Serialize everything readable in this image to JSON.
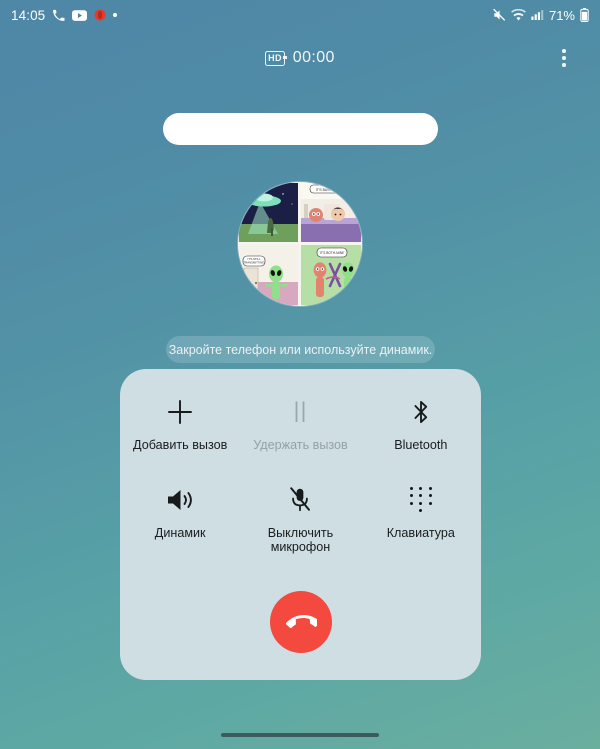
{
  "status_bar": {
    "time": "14:05",
    "battery_percent": "71%",
    "left_icons": [
      "phone-icon",
      "youtube-icon",
      "opera-icon",
      "notification-dot-icon"
    ],
    "right_icons": [
      "mute-icon",
      "wifi-icon",
      "signal-icon",
      "battery-icon"
    ],
    "colors": {
      "foreground": "#ffffff"
    }
  },
  "call_header": {
    "hd_badge": "HD",
    "timer": "00:00",
    "overflow_label": "more-options"
  },
  "caller": {
    "name": "",
    "avatar_alt": "alien-comic-strip-avatar"
  },
  "hint": {
    "text": "Закройте телефон или используйте динамик."
  },
  "controls": [
    {
      "id": "add-call",
      "icon": "plus-icon",
      "label": "Добавить вызов",
      "enabled": true
    },
    {
      "id": "hold-call",
      "icon": "pause-icon",
      "label": "Удержать вызов",
      "enabled": false
    },
    {
      "id": "bluetooth",
      "icon": "bluetooth-icon",
      "label": "Bluetooth",
      "enabled": true
    },
    {
      "id": "speaker",
      "icon": "speaker-icon",
      "label": "Динамик",
      "enabled": true
    },
    {
      "id": "mute-mic",
      "icon": "microphone-off-icon",
      "label": "Выключить микрофон",
      "enabled": true
    },
    {
      "id": "keypad",
      "icon": "keypad-icon",
      "label": "Клавиатура",
      "enabled": true
    }
  ],
  "end_call": {
    "label": "end-call",
    "color": "#f4493f"
  },
  "theme": {
    "background_top": "#4f87a6",
    "background_bottom": "#6aae9e",
    "panel": "#cedee3",
    "text_primary": "#1b1d1e",
    "text_disabled": "#94a2a7"
  }
}
